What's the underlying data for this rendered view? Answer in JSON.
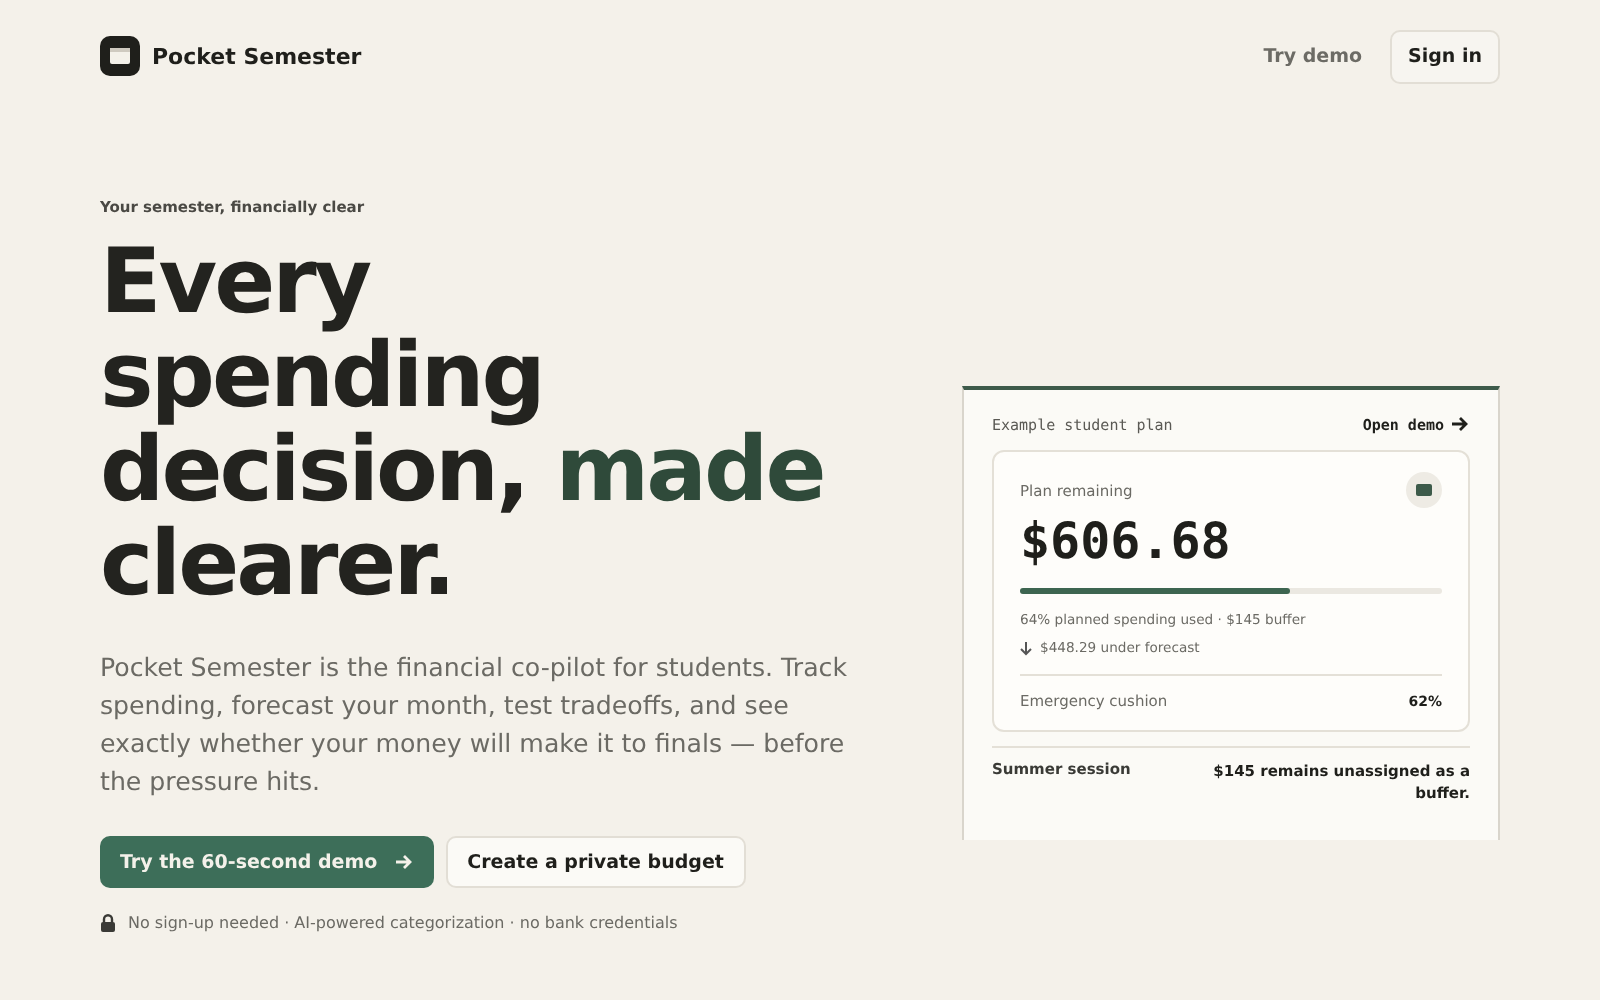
{
  "header": {
    "brand": "Pocket Semester",
    "links": [
      {
        "label": "Try demo",
        "kind": "link"
      },
      {
        "label": "Sign in",
        "kind": "button"
      }
    ]
  },
  "hero": {
    "eyebrow": "Your semester, financially clear",
    "headline": [
      {
        "text": "Every spending decision, ",
        "accent": false
      },
      {
        "text": "made",
        "accent": true
      },
      {
        "text": " clearer.",
        "accent": false
      }
    ],
    "body": "Pocket Semester is the financial co-pilot for students. Track spending, forecast your month, test tradeoffs, and see exactly whether your money will make it to finals — before the pressure hits.",
    "buttons": [
      {
        "label": "Try the 60-second demo",
        "kind": "primary"
      },
      {
        "label": "Create a private budget",
        "kind": "secondary"
      }
    ],
    "note": "No sign-up needed · AI-powered categorization · no bank credentials"
  },
  "plan_card": {
    "title": "Example student plan",
    "link": "Open demo",
    "label": "Plan remaining",
    "amount": "$606.68",
    "level": 0.64,
    "summary": "64% planned spending used · $145 buffer",
    "forecast": "$448.29 under forecast",
    "cushion": {
      "label": "Emergency cushion",
      "value": "62%"
    },
    "footer": {
      "label": "Summer session",
      "text": "$145 remains unassigned as a buffer."
    }
  }
}
